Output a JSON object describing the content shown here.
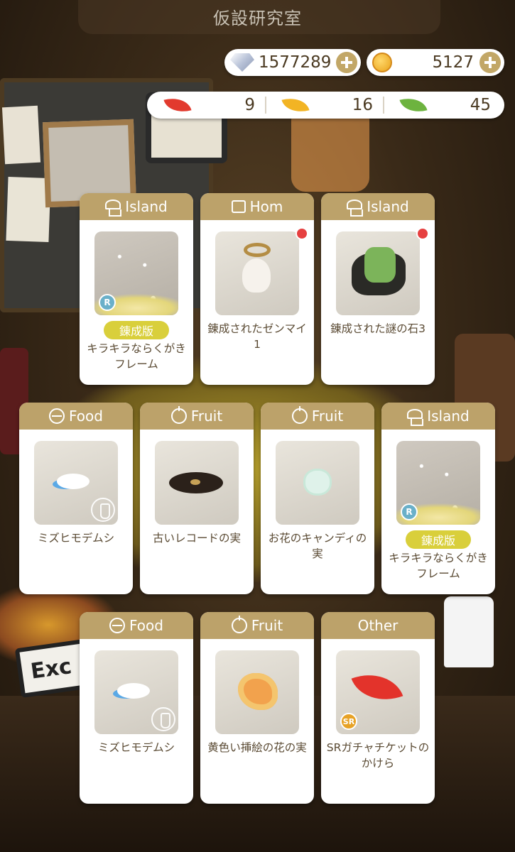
{
  "header": {
    "title": "仮設研究室"
  },
  "currency": {
    "diamonds": {
      "icon": "diamond-icon",
      "value": "1577289"
    },
    "coins": {
      "icon": "coin-icon",
      "value": "5127"
    }
  },
  "leaves": [
    {
      "icon": "red-leaf-icon",
      "color": "#e23a2e",
      "value": "9"
    },
    {
      "icon": "yellow-leaf-icon",
      "color": "#f2b424",
      "value": "16"
    },
    {
      "icon": "green-leaf-icon",
      "color": "#6db33f",
      "value": "45"
    }
  ],
  "cards": [
    {
      "category": "Island",
      "icon": "island-icon",
      "tag": "錬成版",
      "rarity": "R",
      "name": "キラキラならくがきフレーム"
    },
    {
      "category": "Hom",
      "icon": "shirt-icon",
      "name": "錬成されたゼンマイ1",
      "new": true
    },
    {
      "category": "Island",
      "icon": "island-icon",
      "name": "錬成された謎の石3",
      "new": true
    },
    {
      "category": "Food",
      "icon": "food-icon",
      "name": "ミズヒモデムシ"
    },
    {
      "category": "Fruit",
      "icon": "fruit-icon",
      "name": "古いレコードの実"
    },
    {
      "category": "Fruit",
      "icon": "fruit-icon",
      "name": "お花のキャンディの実"
    },
    {
      "category": "Island",
      "icon": "island-icon",
      "tag": "錬成版",
      "rarity": "R",
      "name": "キラキラならくがきフレーム"
    },
    {
      "category": "Food",
      "icon": "food-icon",
      "name": "ミズヒモデムシ"
    },
    {
      "category": "Fruit",
      "icon": "fruit-icon",
      "name": "黄色い挿絵の花の実"
    },
    {
      "category": "Other",
      "icon": "",
      "rarity": "SR",
      "name": "SRガチャチケットのかけら"
    }
  ],
  "background": {
    "sign_text": "Exc"
  }
}
